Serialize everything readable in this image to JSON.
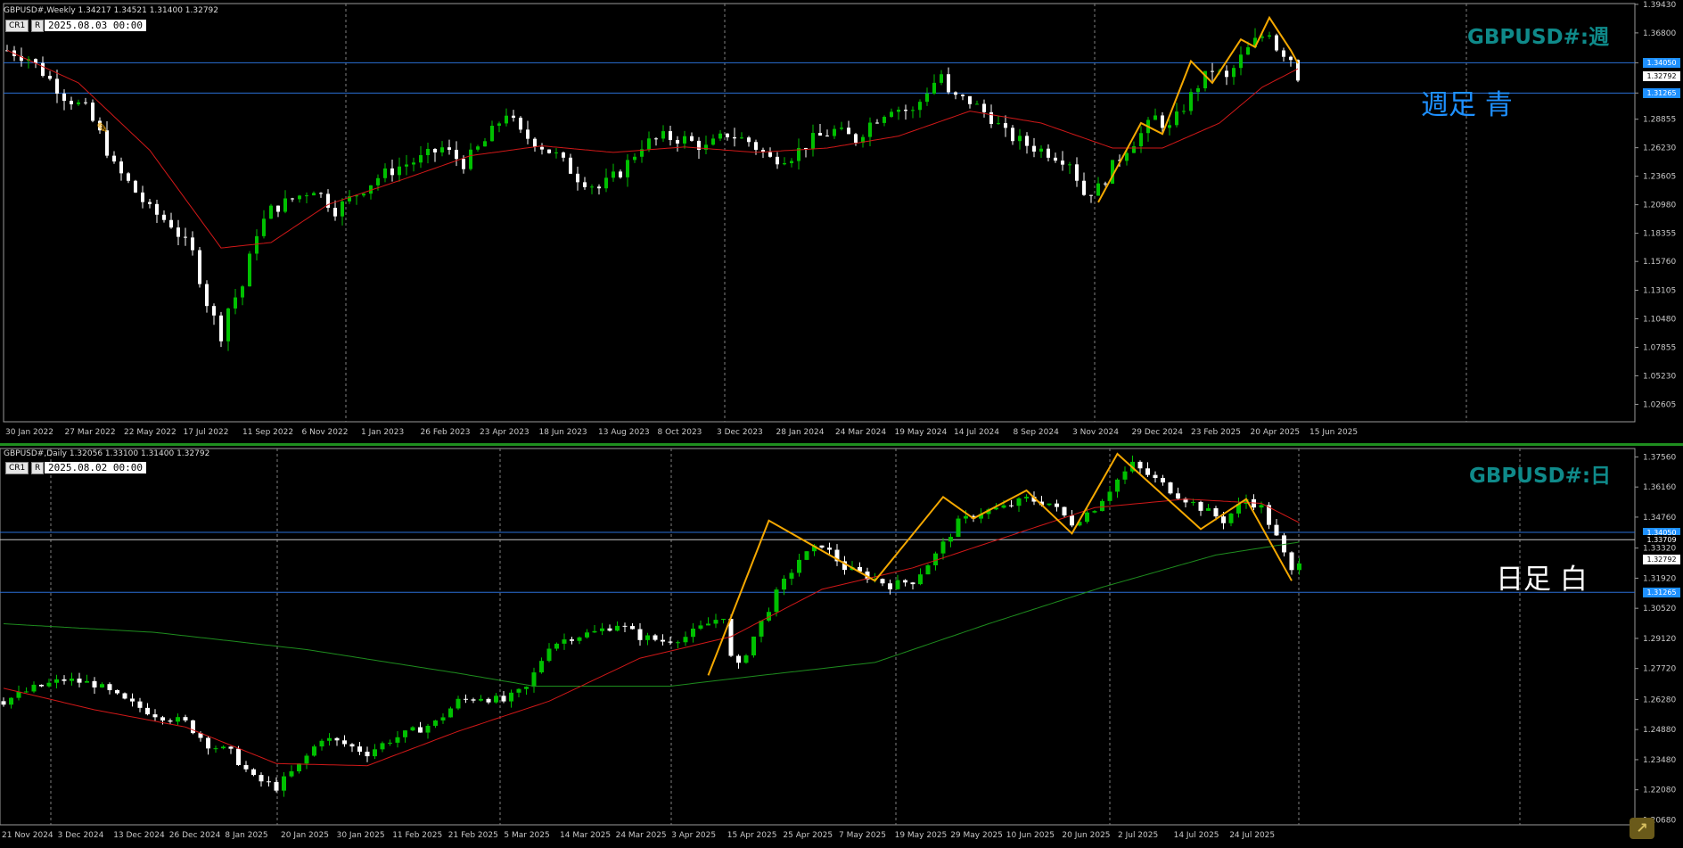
{
  "weekly": {
    "symbol_line": "GBPUSD#,Weekly  1.34217 1.34521 1.31400 1.32792",
    "tag_cr": "CR1",
    "tag_r": "R",
    "date_box": "2025.08.03 00:00",
    "watermark": "GBPUSD#:週",
    "note": "週足 青",
    "note_color": "#1e90ff",
    "price_tags": [
      {
        "label": "1.34050",
        "style": "blue",
        "price": 1.3405
      },
      {
        "label": "1.32792",
        "style": "white",
        "price": 1.32792
      },
      {
        "label": "1.31265",
        "style": "blue",
        "price": 1.31265
      }
    ]
  },
  "daily": {
    "symbol_line": "GBPUSD#,Daily  1.32056 1.33100 1.31400 1.32792",
    "tag_cr": "CR1",
    "tag_r": "R",
    "date_box": "2025.08.02 00:00",
    "watermark": "GBPUSD#:日",
    "note": "日足 白",
    "note_color": "#ffffff",
    "price_tags": [
      {
        "label": "1.34050",
        "style": "blue",
        "price": 1.3405
      },
      {
        "label": "1.33709",
        "style": "black",
        "price": 1.33709
      },
      {
        "label": "1.32792",
        "style": "white",
        "price": 1.32792
      },
      {
        "label": "1.31265",
        "style": "blue",
        "price": 1.31265
      }
    ]
  },
  "colors": {
    "bull": "#00c000",
    "bear": "#ffffff",
    "ma_fast": "#d01818",
    "ma_slow": "#1e8c1e",
    "zigzag": "#f5a800",
    "hline": "#2a6fd6",
    "grid": "#808080",
    "axis_text": "#c8c8c8"
  },
  "chart_data": [
    {
      "type": "candlestick",
      "timeframe": "Weekly",
      "symbol": "GBPUSD#",
      "ylim": [
        1.01,
        1.395
      ],
      "y_ticks": [
        "1.39430",
        "1.36800",
        "1.34050",
        "1.31265",
        "1.28855",
        "1.26230",
        "1.23605",
        "1.20980",
        "1.18355",
        "1.15760",
        "1.13105",
        "1.10480",
        "1.07855",
        "1.05230",
        "1.02605"
      ],
      "x_ticks": [
        "30 Jan 2022",
        "27 Mar 2022",
        "22 May 2022",
        "17 Jul 2022",
        "11 Sep 2022",
        "6 Nov 2022",
        "1 Jan 2023",
        "26 Feb 2023",
        "23 Apr 2023",
        "18 Jun 2023",
        "13 Aug 2023",
        "8 Oct 2023",
        "3 Dec 2023",
        "28 Jan 2024",
        "24 Mar 2024",
        "19 May 2024",
        "14 Jul 2024",
        "8 Sep 2024",
        "3 Nov 2024",
        "29 Dec 2024",
        "23 Feb 2025",
        "20 Apr 2025",
        "15 Jun 2025"
      ],
      "horizontal_lines": [
        1.3405,
        1.31265
      ],
      "close_path": [
        [
          0,
          1.352
        ],
        [
          3,
          1.345
        ],
        [
          6,
          1.325
        ],
        [
          8,
          1.31
        ],
        [
          11,
          1.298
        ],
        [
          13,
          1.275
        ],
        [
          15,
          1.245
        ],
        [
          17,
          1.23
        ],
        [
          20,
          1.205
        ],
        [
          23,
          1.192
        ],
        [
          26,
          1.165
        ],
        [
          28,
          1.12
        ],
        [
          30,
          1.09
        ],
        [
          31,
          1.115
        ],
        [
          33,
          1.135
        ],
        [
          35,
          1.185
        ],
        [
          37,
          1.205
        ],
        [
          40,
          1.215
        ],
        [
          43,
          1.225
        ],
        [
          46,
          1.205
        ],
        [
          49,
          1.22
        ],
        [
          52,
          1.235
        ],
        [
          55,
          1.245
        ],
        [
          58,
          1.252
        ],
        [
          61,
          1.262
        ],
        [
          64,
          1.248
        ],
        [
          67,
          1.268
        ],
        [
          70,
          1.295
        ],
        [
          72,
          1.275
        ],
        [
          74,
          1.268
        ],
        [
          77,
          1.255
        ],
        [
          80,
          1.235
        ],
        [
          83,
          1.225
        ],
        [
          86,
          1.24
        ],
        [
          89,
          1.265
        ],
        [
          92,
          1.272
        ],
        [
          95,
          1.27
        ],
        [
          98,
          1.262
        ],
        [
          101,
          1.275
        ],
        [
          104,
          1.268
        ],
        [
          107,
          1.252
        ],
        [
          110,
          1.255
        ],
        [
          113,
          1.27
        ],
        [
          116,
          1.278
        ],
        [
          119,
          1.27
        ],
        [
          121,
          1.285
        ],
        [
          124,
          1.3
        ],
        [
          127,
          1.295
        ],
        [
          129,
          1.315
        ],
        [
          131,
          1.33
        ],
        [
          132,
          1.31
        ],
        [
          135,
          1.305
        ],
        [
          138,
          1.29
        ],
        [
          140,
          1.275
        ],
        [
          143,
          1.265
        ],
        [
          146,
          1.258
        ],
        [
          149,
          1.25
        ],
        [
          151,
          1.22
        ],
        [
          153,
          1.225
        ],
        [
          155,
          1.245
        ],
        [
          157,
          1.262
        ],
        [
          159,
          1.275
        ],
        [
          161,
          1.29
        ],
        [
          163,
          1.28
        ],
        [
          165,
          1.3
        ],
        [
          167,
          1.32
        ],
        [
          169,
          1.335
        ],
        [
          171,
          1.325
        ],
        [
          173,
          1.345
        ],
        [
          175,
          1.36
        ],
        [
          177,
          1.37
        ],
        [
          178,
          1.355
        ],
        [
          180,
          1.345
        ],
        [
          181,
          1.328
        ]
      ],
      "moving_average_red": [
        [
          0,
          1.352
        ],
        [
          10,
          1.322
        ],
        [
          20,
          1.26
        ],
        [
          30,
          1.17
        ],
        [
          37,
          1.175
        ],
        [
          45,
          1.21
        ],
        [
          55,
          1.232
        ],
        [
          65,
          1.255
        ],
        [
          75,
          1.264
        ],
        [
          85,
          1.258
        ],
        [
          95,
          1.263
        ],
        [
          105,
          1.258
        ],
        [
          115,
          1.262
        ],
        [
          125,
          1.273
        ],
        [
          135,
          1.296
        ],
        [
          145,
          1.285
        ],
        [
          155,
          1.262
        ],
        [
          162,
          1.262
        ],
        [
          170,
          1.285
        ],
        [
          176,
          1.318
        ],
        [
          181,
          1.335
        ]
      ],
      "zigzag": [
        [
          153,
          1.212
        ],
        [
          159,
          1.285
        ],
        [
          162,
          1.275
        ],
        [
          166,
          1.342
        ],
        [
          169,
          1.322
        ],
        [
          173,
          1.362
        ],
        [
          175,
          1.355
        ],
        [
          177,
          1.382
        ],
        [
          180,
          1.352
        ],
        [
          181,
          1.34
        ]
      ]
    },
    {
      "type": "candlestick",
      "timeframe": "Daily",
      "symbol": "GBPUSD#",
      "ylim": [
        1.2045,
        1.3795
      ],
      "y_ticks": [
        "1.37560",
        "1.36160",
        "1.34760",
        "1.33320",
        "1.31920",
        "1.30520",
        "1.29120",
        "1.27720",
        "1.26280",
        "1.24880",
        "1.23480",
        "1.22080",
        "1.20680"
      ],
      "x_ticks": [
        "21 Nov 2024",
        "3 Dec 2024",
        "13 Dec 2024",
        "26 Dec 2024",
        "8 Jan 2025",
        "20 Jan 2025",
        "30 Jan 2025",
        "11 Feb 2025",
        "21 Feb 2025",
        "5 Mar 2025",
        "14 Mar 2025",
        "24 Mar 2025",
        "3 Apr 2025",
        "15 Apr 2025",
        "25 Apr 2025",
        "7 May 2025",
        "19 May 2025",
        "29 May 2025",
        "10 Jun 2025",
        "20 Jun 2025",
        "2 Jul 2025",
        "14 Jul 2025",
        "24 Jul 2025"
      ],
      "horizontal_lines": [
        1.3405,
        1.33709,
        1.31265
      ],
      "close_path": [
        [
          0,
          1.262
        ],
        [
          4,
          1.268
        ],
        [
          8,
          1.272
        ],
        [
          12,
          1.27
        ],
        [
          16,
          1.262
        ],
        [
          20,
          1.256
        ],
        [
          24,
          1.252
        ],
        [
          27,
          1.242
        ],
        [
          30,
          1.238
        ],
        [
          33,
          1.226
        ],
        [
          36,
          1.222
        ],
        [
          39,
          1.232
        ],
        [
          42,
          1.245
        ],
        [
          45,
          1.242
        ],
        [
          48,
          1.238
        ],
        [
          51,
          1.244
        ],
        [
          54,
          1.248
        ],
        [
          57,
          1.252
        ],
        [
          60,
          1.262
        ],
        [
          63,
          1.264
        ],
        [
          66,
          1.262
        ],
        [
          69,
          1.268
        ],
        [
          72,
          1.288
        ],
        [
          75,
          1.292
        ],
        [
          78,
          1.294
        ],
        [
          81,
          1.298
        ],
        [
          84,
          1.292
        ],
        [
          87,
          1.29
        ],
        [
          90,
          1.292
        ],
        [
          93,
          1.298
        ],
        [
          95,
          1.302
        ],
        [
          96,
          1.282
        ],
        [
          97,
          1.278
        ],
        [
          99,
          1.292
        ],
        [
          102,
          1.312
        ],
        [
          105,
          1.328
        ],
        [
          108,
          1.335
        ],
        [
          111,
          1.324
        ],
        [
          114,
          1.32
        ],
        [
          117,
          1.316
        ],
        [
          120,
          1.318
        ],
        [
          123,
          1.33
        ],
        [
          126,
          1.345
        ],
        [
          129,
          1.35
        ],
        [
          132,
          1.352
        ],
        [
          135,
          1.356
        ],
        [
          138,
          1.354
        ],
        [
          141,
          1.345
        ],
        [
          144,
          1.352
        ],
        [
          147,
          1.365
        ],
        [
          149,
          1.372
        ],
        [
          152,
          1.365
        ],
        [
          155,
          1.358
        ],
        [
          158,
          1.352
        ],
        [
          161,
          1.346
        ],
        [
          164,
          1.356
        ],
        [
          166,
          1.352
        ],
        [
          168,
          1.338
        ],
        [
          170,
          1.322
        ],
        [
          171,
          1.328
        ]
      ],
      "moving_average_red": [
        [
          0,
          1.268
        ],
        [
          12,
          1.258
        ],
        [
          24,
          1.25
        ],
        [
          36,
          1.233
        ],
        [
          48,
          1.232
        ],
        [
          60,
          1.248
        ],
        [
          72,
          1.262
        ],
        [
          84,
          1.282
        ],
        [
          96,
          1.292
        ],
        [
          108,
          1.314
        ],
        [
          120,
          1.324
        ],
        [
          132,
          1.338
        ],
        [
          144,
          1.352
        ],
        [
          156,
          1.356
        ],
        [
          166,
          1.354
        ],
        [
          171,
          1.345
        ]
      ],
      "moving_average_green": [
        [
          0,
          1.298
        ],
        [
          20,
          1.294
        ],
        [
          40,
          1.286
        ],
        [
          60,
          1.275
        ],
        [
          70,
          1.269
        ],
        [
          88,
          1.269
        ],
        [
          100,
          1.274
        ],
        [
          115,
          1.28
        ],
        [
          130,
          1.298
        ],
        [
          145,
          1.315
        ],
        [
          160,
          1.33
        ],
        [
          171,
          1.336
        ]
      ],
      "zigzag": [
        [
          93,
          1.274
        ],
        [
          101,
          1.346
        ],
        [
          115,
          1.318
        ],
        [
          124,
          1.357
        ],
        [
          128,
          1.347
        ],
        [
          135,
          1.36
        ],
        [
          141,
          1.34
        ],
        [
          147,
          1.377
        ],
        [
          158,
          1.342
        ],
        [
          164,
          1.356
        ],
        [
          170,
          1.318
        ]
      ]
    }
  ]
}
